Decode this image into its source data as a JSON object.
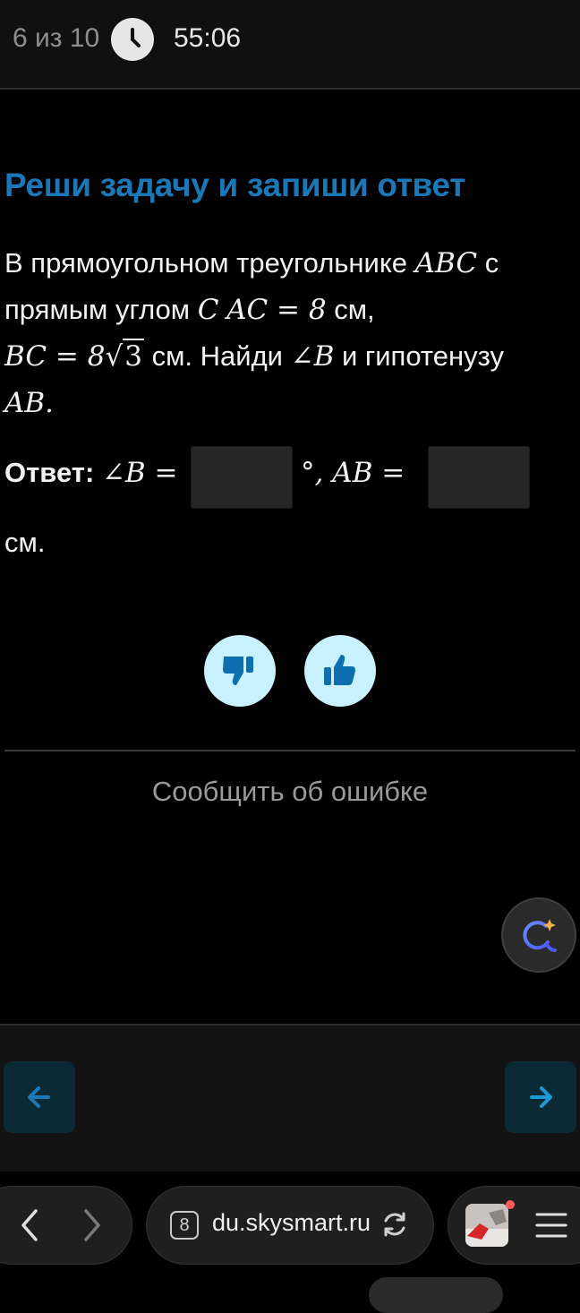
{
  "header": {
    "counter": "6 из 10",
    "timer": "55:06"
  },
  "task": {
    "heading": "Реши задачу и запиши ответ",
    "line1_text": "В прямоугольном треугольнике ",
    "line1_math": "ABC",
    "line1_end": " с",
    "line2_text": "прямым углом ",
    "line2_math_c": "C",
    "line2_math_eq": "AC = 8",
    "line2_end": " см,",
    "line3_math": "BC = 8",
    "line3_sqrt": "3",
    "line3_text": " см. Найди ",
    "line3_angle": "∠B",
    "line3_end": " и гипотенузу",
    "line4_math": "AB."
  },
  "answer": {
    "label": "Ответ:",
    "angle_expr": "∠B =",
    "degree_ab": "°, AB =",
    "unit": "см.",
    "input1_value": "",
    "input2_value": ""
  },
  "feedback": {
    "dislike_icon": "thumbs-down-icon",
    "like_icon": "thumbs-up-icon"
  },
  "report_label": "Сообщить об ошибке",
  "navigation": {
    "prev_icon": "arrow-left-icon",
    "next_icon": "arrow-right-icon"
  },
  "browser": {
    "tab_count": "8",
    "url": "du.skysmart.ru"
  },
  "colors": {
    "accent": "#1a78b8",
    "vote_bg": "#c9f1ff",
    "nav_bg": "#0c2a36"
  }
}
